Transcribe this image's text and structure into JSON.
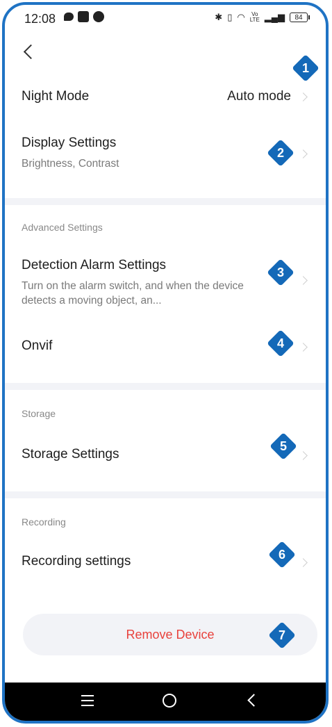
{
  "status_bar": {
    "time": "12:08",
    "battery": "84",
    "network_top": "Vo",
    "network_bottom": "LTE",
    "icons_left": [
      "chat-bubble-icon",
      "app-notification-icon",
      "gear-icon"
    ],
    "icons_right": [
      "bluetooth-icon",
      "vibrate-icon",
      "wifi-icon",
      "lte-icon",
      "signal-icon",
      "battery-icon"
    ]
  },
  "header": {
    "back_icon": "chevron-left-icon"
  },
  "rows": {
    "night_mode": {
      "title": "Night Mode",
      "value": "Auto mode"
    },
    "display": {
      "title": "Display Settings",
      "subtitle": "Brightness, Contrast"
    },
    "detection": {
      "title": "Detection Alarm Settings",
      "subtitle": "Turn on the alarm switch, and when the device detects a moving object, an..."
    },
    "onvif": {
      "title": "Onvif"
    },
    "storage": {
      "title": "Storage Settings"
    },
    "recording": {
      "title": "Recording settings"
    }
  },
  "sections": {
    "advanced": "Advanced Settings",
    "storage": "Storage",
    "recording": "Recording"
  },
  "remove_device": "Remove Device",
  "markers": [
    "1",
    "2",
    "3",
    "4",
    "5",
    "6",
    "7"
  ],
  "colors": {
    "frame": "#1f73c4",
    "marker": "#1469b8",
    "danger": "#e8413c",
    "divider": "#f2f3f7"
  },
  "nav_bar": {
    "icons": [
      "menu-icon",
      "home-icon",
      "back-icon"
    ]
  }
}
